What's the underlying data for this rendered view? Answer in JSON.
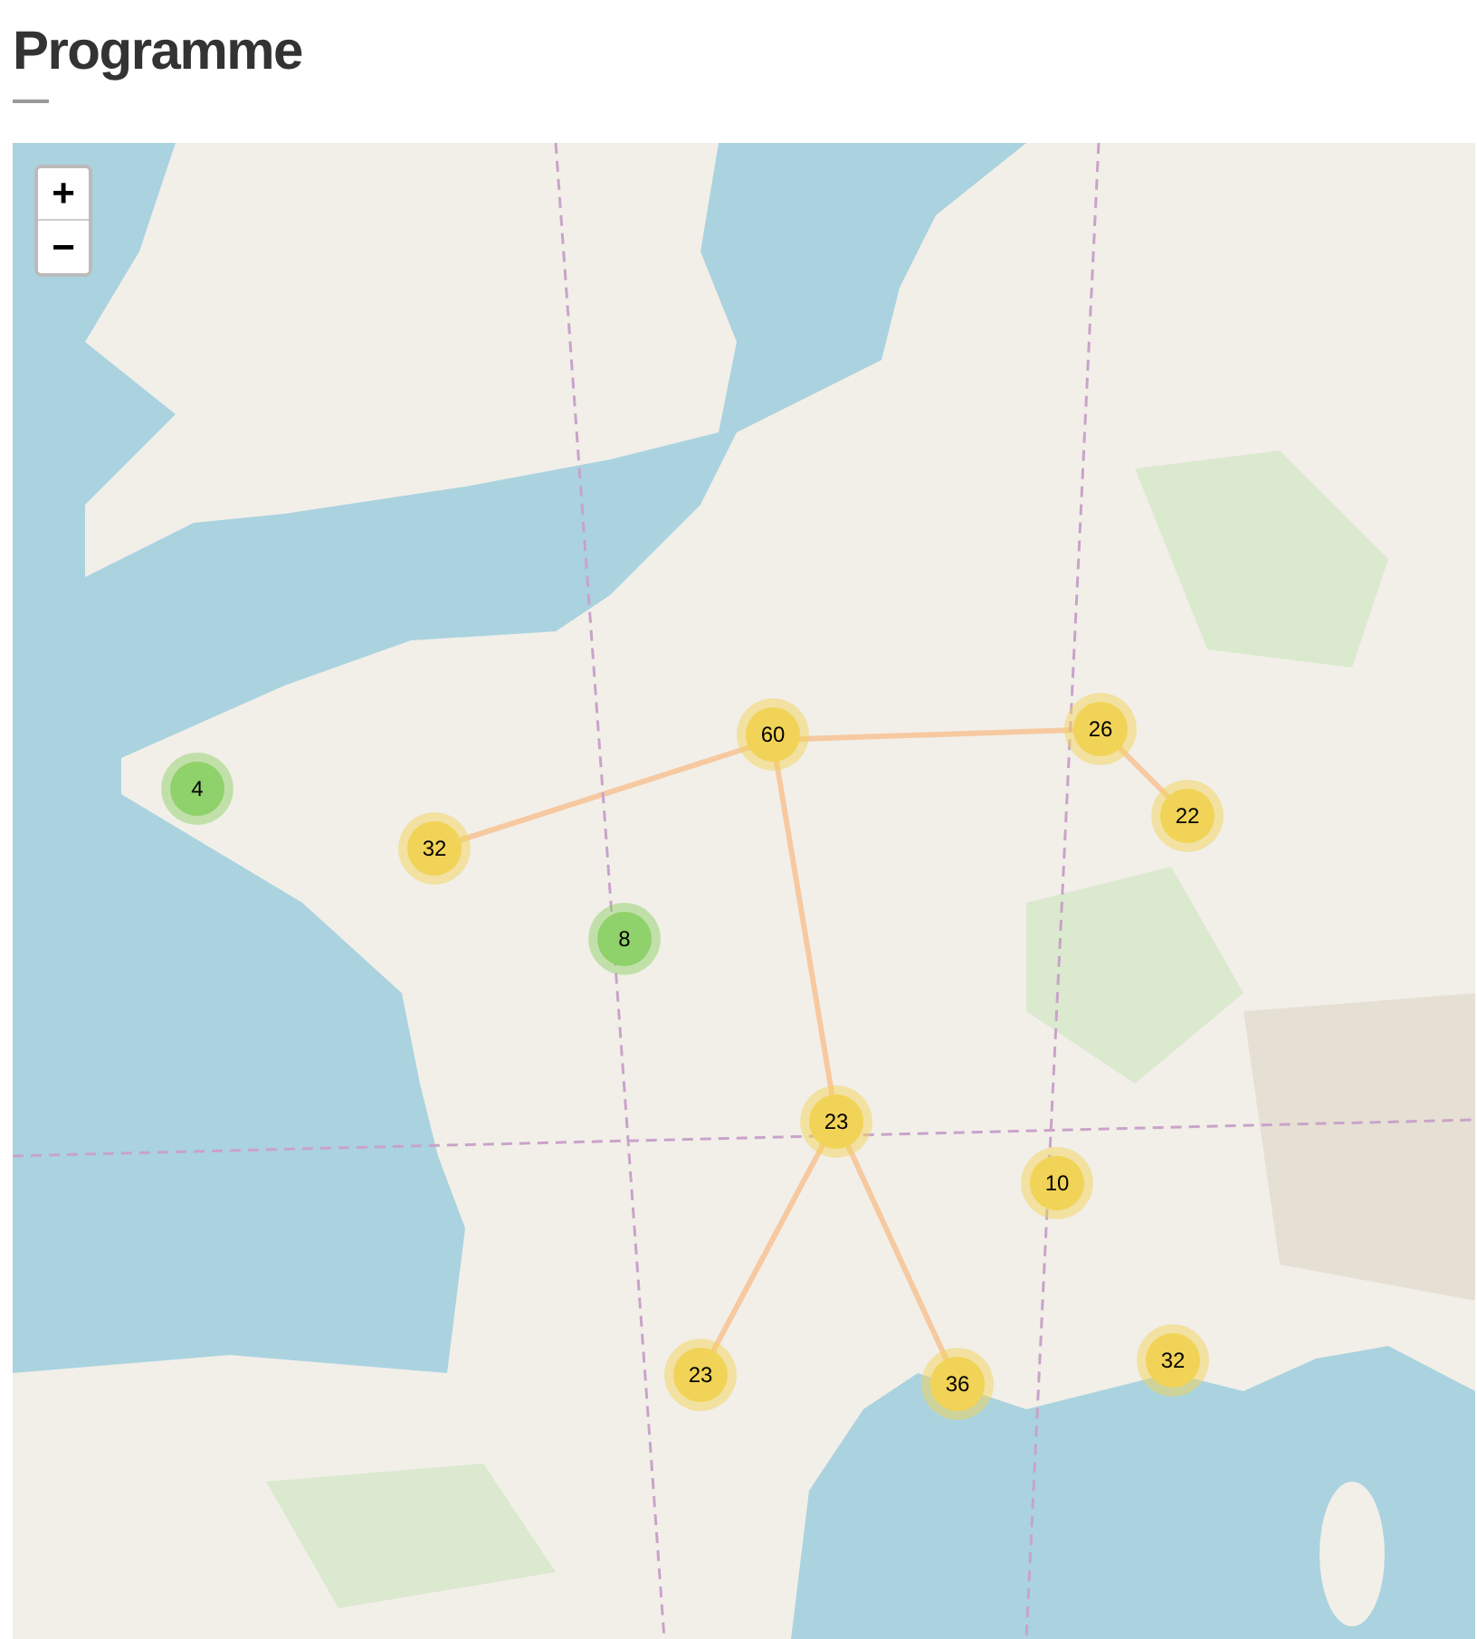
{
  "title": "Programme",
  "zoom_controls": [
    {
      "label": "+"
    },
    {
      "label": "−"
    }
  ],
  "clusters": [
    {
      "count": "4",
      "color": "#8fd16a"
    },
    {
      "count": "32",
      "color": "#f1d357"
    },
    {
      "count": "8",
      "color": "#8fd16a"
    },
    {
      "count": "60",
      "color": "#f1d357"
    },
    {
      "count": "26",
      "color": "#f1d357"
    },
    {
      "count": "22",
      "color": "#f1d357"
    },
    {
      "count": "23",
      "color": "#f1d357"
    },
    {
      "count": "10",
      "color": "#f1d357"
    },
    {
      "count": "23",
      "color": "#f1d357"
    },
    {
      "count": "36",
      "color": "#f1d357"
    },
    {
      "count": "32",
      "color": "#f1d357"
    }
  ]
}
